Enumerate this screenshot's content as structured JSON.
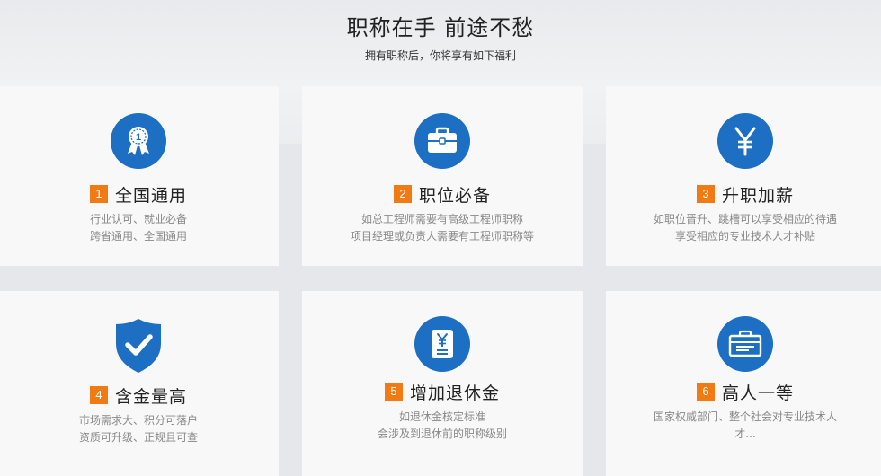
{
  "header": {
    "title": "职称在手 前途不愁",
    "subtitle": "拥有职称后，你将享有如下福利"
  },
  "colors": {
    "accent_blue": "#1c6fc2",
    "badge_orange": "#f07a14"
  },
  "cards": [
    {
      "num": "1",
      "title": "全国通用",
      "icon": "award-medal-icon",
      "lines": [
        "行业认可、就业必备",
        "跨省通用、全国通用"
      ]
    },
    {
      "num": "2",
      "title": "职位必备",
      "icon": "briefcase-icon",
      "lines": [
        "如总工程师需要有高级工程师职称",
        "项目经理或负责人需要有工程师职称等"
      ]
    },
    {
      "num": "3",
      "title": "升职加薪",
      "icon": "yen-icon",
      "lines": [
        "如职位晋升、跳槽可以享受相应的待遇",
        "享受相应的专业技术人才补贴"
      ]
    },
    {
      "num": "4",
      "title": "含金量高",
      "icon": "shield-check-icon",
      "lines": [
        "市场需求大、积分可落户",
        "资质可升级、正规且可查"
      ]
    },
    {
      "num": "5",
      "title": "增加退休金",
      "icon": "yen-document-icon",
      "lines": [
        "如退休金核定标准",
        "会涉及到退休前的职称级别"
      ]
    },
    {
      "num": "6",
      "title": "高人一等",
      "icon": "certificate-case-icon",
      "lines": [
        "国家权威部门、整个社会对专业技术人",
        "才..."
      ]
    }
  ]
}
